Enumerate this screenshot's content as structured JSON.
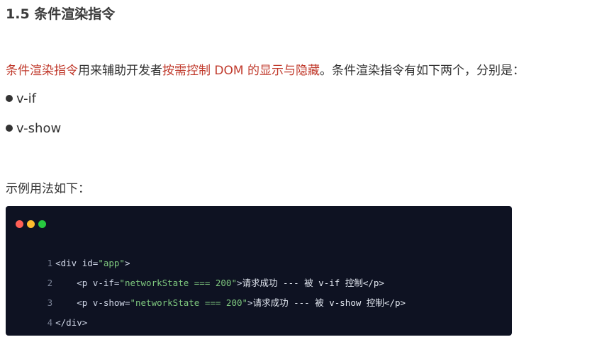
{
  "section": {
    "heading": "1.5 条件渲染指令"
  },
  "intro": {
    "part1": "条件渲染指令",
    "part2": "用来辅助开发者",
    "part3": "按需控制 DOM 的显示与隐藏",
    "part4": "。条件渲染指令有如下两个，分别是："
  },
  "bullets": [
    {
      "label": "v-if"
    },
    {
      "label": "v-show"
    }
  ],
  "example_label": "示例用法如下：",
  "code": {
    "window_light_colors": [
      "#ff5f56",
      "#ffbd2e",
      "#27c93f"
    ],
    "lines": [
      {
        "num": "1",
        "t1": "<div id=",
        "s1": "\"app\"",
        "t2": ">",
        "body": ""
      },
      {
        "num": "2",
        "t1": "    <p v-if=",
        "s1": "\"networkState === 200\"",
        "t2": ">",
        "body": "请求成功 --- 被 v-if 控制</p>"
      },
      {
        "num": "3",
        "t1": "    <p v-show=",
        "s1": "\"networkState === 200\"",
        "t2": ">",
        "body": "请求成功 --- 被 v-show 控制</p>"
      },
      {
        "num": "4",
        "t1": "</div>",
        "s1": "",
        "t2": "",
        "body": ""
      }
    ]
  }
}
